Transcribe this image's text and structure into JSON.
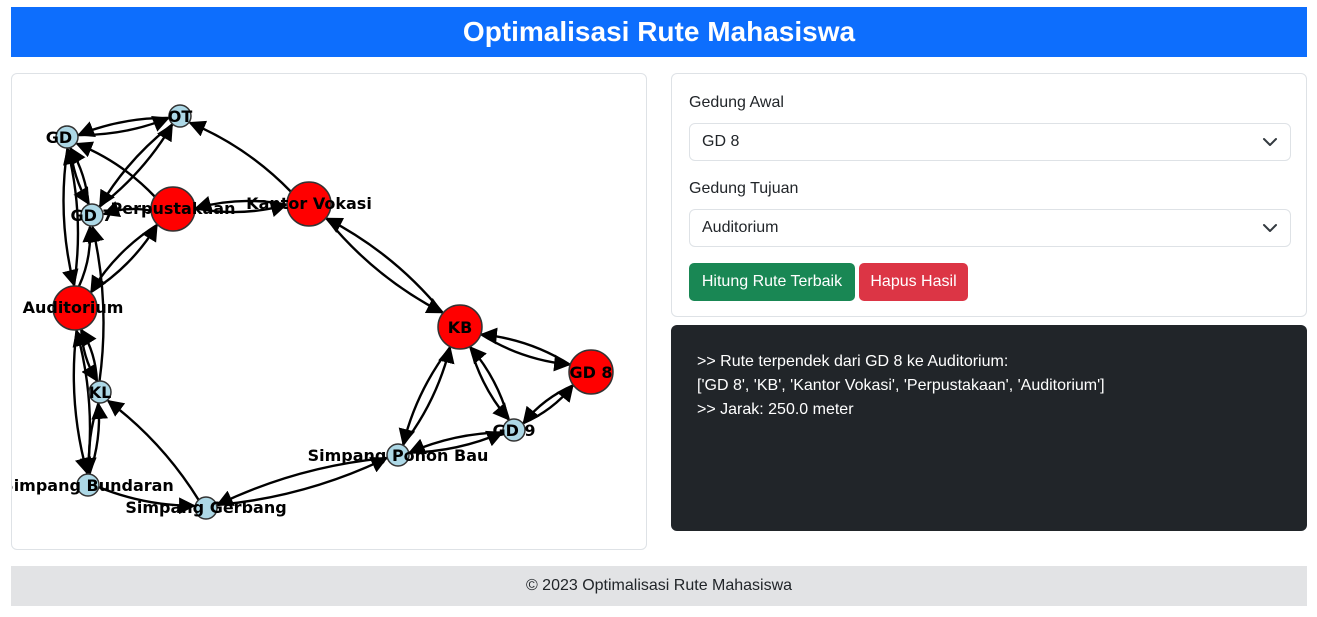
{
  "header": {
    "title": "Optimalisasi Rute Mahasiswa"
  },
  "form": {
    "start_label": "Gedung Awal",
    "start_value": "GD 8",
    "end_label": "Gedung Tujuan",
    "end_value": "Auditorium",
    "calc_button": "Hitung Rute Terbaik",
    "clear_button": "Hapus Hasil"
  },
  "result": {
    "line1": ">> Rute terpendek dari GD 8 ke Auditorium:",
    "line2": "['GD 8', 'KB', 'Kantor Vokasi', 'Perpustakaan', 'Auditorium']",
    "line3": ">> Jarak: 250.0 meter"
  },
  "graph": {
    "nodes": [
      {
        "id": "GD",
        "label": "GD",
        "highlight": false
      },
      {
        "id": "OT",
        "label": "OT",
        "highlight": false
      },
      {
        "id": "GD7",
        "label": "GD 7",
        "highlight": false
      },
      {
        "id": "Perpustakaan",
        "label": "Perpustakaan",
        "highlight": true
      },
      {
        "id": "KantorVokasi",
        "label": "Kantor Vokasi",
        "highlight": true
      },
      {
        "id": "Auditorium",
        "label": "Auditorium",
        "highlight": true
      },
      {
        "id": "KL",
        "label": "KL",
        "highlight": false
      },
      {
        "id": "KB",
        "label": "KB",
        "highlight": true
      },
      {
        "id": "GD8",
        "label": "GD 8",
        "highlight": true
      },
      {
        "id": "GD9",
        "label": "GD 9",
        "highlight": false
      },
      {
        "id": "SimpangPohonBau",
        "label": "Simpang Pohon Bau",
        "highlight": false
      },
      {
        "id": "SimpangBundaran",
        "label": "Simpang Bundaran",
        "highlight": false
      },
      {
        "id": "SimpangGerbang",
        "label": "Simpang Gerbang",
        "highlight": false
      }
    ],
    "edges": [
      [
        "GD",
        "OT"
      ],
      [
        "OT",
        "GD"
      ],
      [
        "GD",
        "GD7"
      ],
      [
        "GD7",
        "GD"
      ],
      [
        "GD7",
        "OT"
      ],
      [
        "OT",
        "GD7"
      ],
      [
        "Perpustakaan",
        "GD"
      ],
      [
        "Perpustakaan",
        "GD7"
      ],
      [
        "Perpustakaan",
        "KantorVokasi"
      ],
      [
        "KantorVokasi",
        "Perpustakaan"
      ],
      [
        "KantorVokasi",
        "OT"
      ],
      [
        "Perpustakaan",
        "Auditorium"
      ],
      [
        "Auditorium",
        "Perpustakaan"
      ],
      [
        "Auditorium",
        "GD"
      ],
      [
        "GD",
        "Auditorium"
      ],
      [
        "Auditorium",
        "GD7"
      ],
      [
        "Auditorium",
        "KL"
      ],
      [
        "KL",
        "Auditorium"
      ],
      [
        "KL",
        "GD7"
      ],
      [
        "Auditorium",
        "SimpangBundaran"
      ],
      [
        "SimpangBundaran",
        "Auditorium"
      ],
      [
        "KL",
        "SimpangBundaran"
      ],
      [
        "SimpangBundaran",
        "KL"
      ],
      [
        "SimpangGerbang",
        "KL"
      ],
      [
        "SimpangBundaran",
        "SimpangGerbang"
      ],
      [
        "KantorVokasi",
        "KB"
      ],
      [
        "KB",
        "KantorVokasi"
      ],
      [
        "KB",
        "GD8"
      ],
      [
        "GD8",
        "KB"
      ],
      [
        "KB",
        "GD9"
      ],
      [
        "GD9",
        "KB"
      ],
      [
        "GD8",
        "GD9"
      ],
      [
        "GD9",
        "GD8"
      ],
      [
        "KB",
        "SimpangPohonBau"
      ],
      [
        "SimpangPohonBau",
        "KB"
      ],
      [
        "SimpangPohonBau",
        "GD9"
      ],
      [
        "GD9",
        "SimpangPohonBau"
      ],
      [
        "SimpangPohonBau",
        "SimpangGerbang"
      ],
      [
        "SimpangGerbang",
        "SimpangPohonBau"
      ]
    ],
    "colors": {
      "highlight": "#ff0000",
      "normal": "#add8e6",
      "edge": "#000000"
    }
  },
  "footer": {
    "text": "© 2023 Optimalisasi Rute Mahasiswa"
  }
}
